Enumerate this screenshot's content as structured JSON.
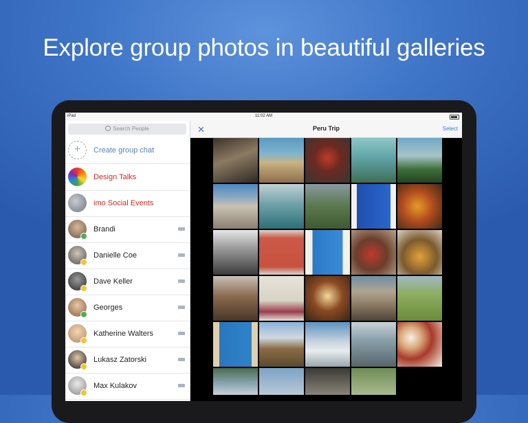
{
  "headline": "Explore group photos in beautiful galleries",
  "statusbar": {
    "carrier": "iPad",
    "time": "11:02 AM"
  },
  "sidebar": {
    "search_placeholder": "Search People",
    "items": [
      {
        "label": "Create group chat",
        "style": "blue",
        "avatar": "plus"
      },
      {
        "label": "Design Talks",
        "style": "red",
        "avatar": "rainbow"
      },
      {
        "label": "imo Social Events",
        "style": "red",
        "avatar": "group"
      },
      {
        "label": "Brandi",
        "style": "normal",
        "badge": "green"
      },
      {
        "label": "Danielle Coe",
        "style": "normal",
        "badge": "yellow"
      },
      {
        "label": "Dave Keller",
        "style": "normal",
        "badge": "yellow"
      },
      {
        "label": "Georges",
        "style": "normal",
        "badge": "green"
      },
      {
        "label": "Katherine Walters",
        "style": "normal",
        "badge": "yellow"
      },
      {
        "label": "Lukasz Zatorski",
        "style": "normal",
        "badge": "yellow"
      },
      {
        "label": "Max Kulakov",
        "style": "normal",
        "badge": "yellow"
      }
    ]
  },
  "gallery": {
    "title": "Peru Trip",
    "select_label": "Select",
    "close_icon": "close-icon"
  },
  "colors": {
    "accent": "#3a7ad8",
    "group_red": "#cc2a1f",
    "background_blue": "#3e74c6"
  }
}
